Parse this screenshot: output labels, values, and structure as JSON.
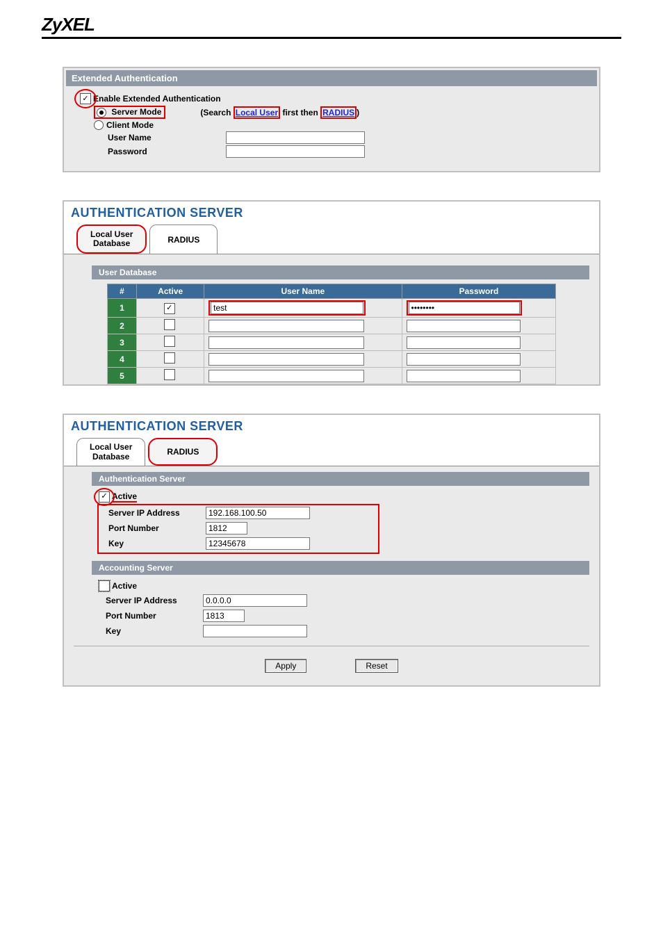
{
  "brand": "ZyXEL",
  "extAuth": {
    "title": "Extended Authentication",
    "enable_label": "Enable Extended Authentication",
    "enable_checked": true,
    "server_mode_label": "Server Mode",
    "server_mode_selected": true,
    "client_mode_label": "Client Mode",
    "client_mode_selected": false,
    "search_prefix": "(Search",
    "search_link1": "Local User",
    "search_mid": "first then",
    "search_link2": "RADIUS",
    "search_suffix": ")",
    "username_label": "User Name",
    "username_value": "",
    "password_label": "Password",
    "password_value": ""
  },
  "authServer1": {
    "page_title": "AUTHENTICATION SERVER",
    "tab_local": "Local User\nDatabase",
    "tab_radius": "RADIUS",
    "sub_title": "User Database",
    "columns": {
      "num": "#",
      "active": "Active",
      "user": "User Name",
      "pass": "Password"
    },
    "rows": [
      {
        "n": "1",
        "active": true,
        "user": "test",
        "pass": "********"
      },
      {
        "n": "2",
        "active": false,
        "user": "",
        "pass": ""
      },
      {
        "n": "3",
        "active": false,
        "user": "",
        "pass": ""
      },
      {
        "n": "4",
        "active": false,
        "user": "",
        "pass": ""
      },
      {
        "n": "5",
        "active": false,
        "user": "",
        "pass": ""
      }
    ]
  },
  "authServer2": {
    "page_title": "AUTHENTICATION SERVER",
    "tab_local": "Local User\nDatabase",
    "tab_radius": "RADIUS",
    "auth_section": "Authentication Server",
    "acct_section": "Accounting Server",
    "labels": {
      "active": "Active",
      "ip": "Server IP Address",
      "port": "Port Number",
      "key": "Key"
    },
    "auth": {
      "active": true,
      "ip": "192.168.100.50",
      "port": "1812",
      "key": "12345678"
    },
    "acct": {
      "active": false,
      "ip": "0.0.0.0",
      "port": "1813",
      "key": ""
    },
    "btn_apply": "Apply",
    "btn_reset": "Reset"
  }
}
